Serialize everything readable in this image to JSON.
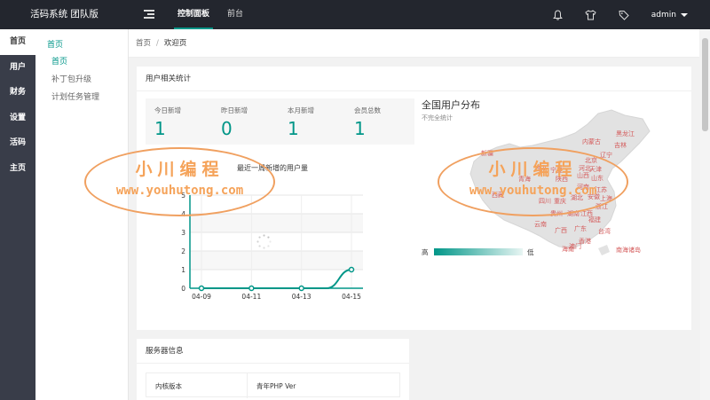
{
  "app": {
    "title": "活码系统 团队版"
  },
  "topnav": {
    "items": [
      "控制面板",
      "前台"
    ],
    "active_index": 0
  },
  "user": {
    "name": "admin"
  },
  "icons": [
    "menu-toggle-icon",
    "bell-icon",
    "shirt-icon",
    "tag-icon",
    "caret-down-icon"
  ],
  "sidebar": {
    "items": [
      {
        "label": "首页",
        "active": true
      },
      {
        "label": "用户"
      },
      {
        "label": "财务"
      },
      {
        "label": "设置"
      },
      {
        "label": "活码"
      },
      {
        "label": "主页"
      }
    ]
  },
  "subnav": {
    "group": "首页",
    "items": [
      {
        "label": "首页",
        "active": true
      },
      {
        "label": "补丁包升级"
      },
      {
        "label": "计划任务管理"
      }
    ]
  },
  "breadcrumb": {
    "home": "首页",
    "sep": "/",
    "current": "欢迎页"
  },
  "stats": {
    "title": "用户相关统计",
    "boxes": [
      {
        "label": "今日新增",
        "value": "1"
      },
      {
        "label": "昨日新增",
        "value": "0"
      },
      {
        "label": "本月新增",
        "value": "1"
      },
      {
        "label": "会员总数",
        "value": "1"
      }
    ]
  },
  "chart_title": "最近一周新增的用户量",
  "chart_data": {
    "type": "line",
    "x": [
      "04-09",
      "04-10",
      "04-11",
      "04-12",
      "04-13",
      "04-14",
      "04-15"
    ],
    "x_ticks": [
      "04-09",
      "04-11",
      "04-13",
      "04-15"
    ],
    "values": [
      0,
      0,
      0,
      0,
      0,
      0,
      1
    ],
    "ylim": [
      0,
      5
    ],
    "y_ticks": [
      "0",
      "1",
      "2",
      "3",
      "4",
      "5"
    ],
    "color": "#009688",
    "grid": true
  },
  "map": {
    "title": "全国用户分布",
    "subtitle": "不完全统计",
    "legend_high": "高",
    "legend_low": "低",
    "labels": [
      "黑龙江",
      "吉林",
      "内蒙古",
      "辽宁",
      "新疆",
      "北京",
      "天津",
      "山东",
      "陕西",
      "河南",
      "江苏",
      "上海",
      "四川",
      "重庆",
      "湖北",
      "浙江",
      "贵州",
      "湖南",
      "江西",
      "福建",
      "云南",
      "广西",
      "广东",
      "台湾",
      "海南",
      "澳门",
      "香港",
      "南海诸岛",
      "甘肃",
      "山西",
      "青海",
      "西藏",
      "宁夏",
      "河北",
      "安徽"
    ]
  },
  "server": {
    "title": "服务器信息",
    "rows": [
      {
        "key": "内核版本",
        "value": "青年PHP Ver"
      }
    ]
  },
  "watermark": {
    "line1": "小川编程",
    "line2": "www.youhutong.com"
  },
  "colors": {
    "accent": "#009688",
    "topbar": "#23262e",
    "sidebar": "#393d49",
    "map_label": "#d45a5a",
    "watermark": "#f5a35a"
  }
}
